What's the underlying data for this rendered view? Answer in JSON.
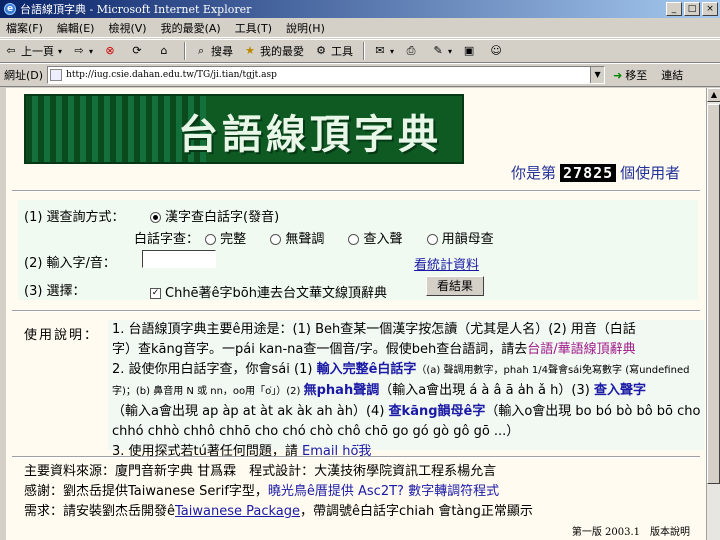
{
  "window": {
    "title": "台語線頂字典 - Microsoft Internet Explorer",
    "buttons": [
      "_",
      "□",
      "×"
    ]
  },
  "menu": [
    "檔案(F)",
    "編輯(E)",
    "檢視(V)",
    "我的最愛(A)",
    "工具(T)",
    "說明(H)"
  ],
  "toolbar": {
    "back": "上一頁",
    "search": "搜尋",
    "favorites": "我的最愛",
    "tools": "工具"
  },
  "address": {
    "label": "網址(D)",
    "url": "http://iug.csie.dahan.edu.tw/TG/ji.tian/tgjt.asp",
    "go": "移至",
    "links": "連結"
  },
  "banner": {
    "title": "台語線頂字典"
  },
  "counter": {
    "prefix": "你是第",
    "value": "27825",
    "suffix": "個使用者"
  },
  "form": {
    "q1_label": "(1) 選查詢方式：",
    "q1_option": "漢字查白話字(發音)",
    "q1_sub_label": "白話字查：",
    "q1_sub_options": [
      "完整",
      "無聲調",
      "查入聲",
      "用韻母查"
    ],
    "q2_label": "(2) 輸入字/音：",
    "q2_link": "看統計資料",
    "q3_label": "(3) 選擇：",
    "q3_option": "Chhē著ê字bōh連去台文華文線頂辭典",
    "submit": "看結果"
  },
  "usage": {
    "label": "使用說明：",
    "l1": "1. 台語線頂字典主要ê用途是：(1) Beh查某一個漢字按怎讀（尤其是人名）(2) 用音（白話",
    "l2a": "字）查kāng音字。一pái kan-na查一個音/字。假使beh查台語詞，請去",
    "l2b": "台語/華語線頂辭典",
    "l3a": "2. 設使你用白話字查，你會sái (1) ",
    "l3b": "輸入完整ê白話字",
    "l3c": "（(a) 聲調用數字，phah 1/4聲會sái免寫數字 (寫undefined",
    "l4a": "字)；(b) 鼻音用 N 或 nn，oo用「o͘」）(2) ",
    "l4b": "無phah聲調",
    "l4c": "（輸入a會出現 á à â ā a̍h ǎ h）(3) ",
    "l4d": "查入聲字",
    "l5a": "（輸入a會出現 ap àp at àt ak àk ah àh）(4) ",
    "l5b": "查kāng韻母ê字",
    "l5c": "（輸入o會出現 bo bó bò bô bō cho",
    "l6": "chhó chhò chhô chhō cho chó chò chô chō go gó gò gô gō ...）",
    "l7a": "3. 使用探式若tú著任何問題，請 ",
    "l7b": "Email hō͘我"
  },
  "footer": {
    "f1": "主要資料來源：廈門音新字典 甘爲霖　程式設計：大漢技術學院資訊工程系楊允言",
    "f2a": "感謝：劉杰岳提供Taiwanese Serif字型，",
    "f2b": "曉光鳥ê厝提供 Asc2T? 數字轉調符程式",
    "f3a": "需求：請安裝劉杰岳開發ê",
    "f3b": "Taiwanese Package",
    "f3c": "，帶調號ê白話字chiah 會tàng正常顯示",
    "edition": "第一版 2003.1　版本說明"
  }
}
